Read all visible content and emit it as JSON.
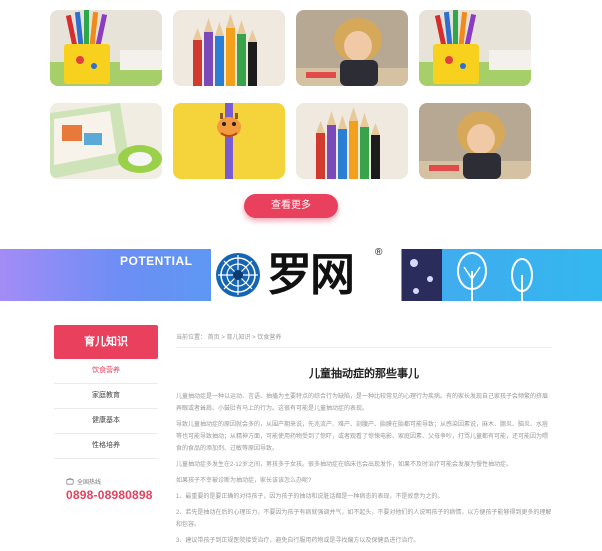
{
  "gallery": {
    "more_button": "查看更多",
    "images": [
      {
        "name": "pencil-cup-image"
      },
      {
        "name": "colored-pencils-image"
      },
      {
        "name": "girl-drawing-image"
      },
      {
        "name": "pencil-cup-image"
      },
      {
        "name": "children-book-image"
      },
      {
        "name": "giraffe-pencil-image"
      },
      {
        "name": "colored-pencils-image"
      },
      {
        "name": "girl-drawing-image"
      }
    ]
  },
  "banner": {
    "potential": "POTENTIAL",
    "colors": {
      "start": "#a48cf6",
      "end": "#33b7ee"
    }
  },
  "logo": {
    "text": "罗网",
    "reg": "®"
  },
  "sidebar": {
    "title": "育儿知识",
    "items": [
      {
        "label": "饮食营养",
        "active": true
      },
      {
        "label": "家庭教育",
        "active": false
      },
      {
        "label": "健康基本",
        "active": false
      },
      {
        "label": "性格培养",
        "active": false
      }
    ],
    "contact_label": "全国热线",
    "phone": "0898-08980898"
  },
  "breadcrumb": "当前位置：  首页 > 育儿知识 > 饮食营养",
  "article": {
    "title": "儿童抽动症的那些事儿",
    "paragraphs": [
      "儿童抽动症是一种以运动、言语、抽搐为主要特点的综合行为缺陷，是一种比较常见的心理行为疾病。有的家长发现自己家孩子会频繁的挤眉弄眼或者耸肩、小鼓肚有马上的行为。这很有可能是儿童抽动症的表现。",
      "导致儿童抽动症的原因就会多的，从围产期来说，先兆流产、难产、剖腹产、胎膜在胎都可能导致；从感染因素说，麻木、腮炎、脑炎、水痘等也可能导致抽动；从精神方面，可能使用药物受到了惊吓，或者观看了惊悚电影、家庭因素、父母争吵，打骂儿童都有可能，还可能因为喂食的食品的添加剂、过敏等原因导致。",
      "儿童抽动症多发生在2-12岁之间，男孩多于女孩。很多抽动症在临床也会出现发作，如果不及时治疗可能会发展为慢性抽动症。",
      "如果孩子不幸被诊断为抽动症，家长该该怎么办呢?",
      "1、最重要的是要正确的对待孩子，因为孩子的抽动和说脏话都是一种病态的表现，不是故意为之的。",
      "2、若先是抽动在后的心理压力，不要因为孩子有病就强调并气，如不起头，不要对他们的人说明孩子的病情，以方便孩子能够得到更多的理解和包容。",
      "3、建议带孩子到正规医院接受治疗，避免自行服用药物或是寻找偏方以及保健品进行治疗。"
    ]
  }
}
